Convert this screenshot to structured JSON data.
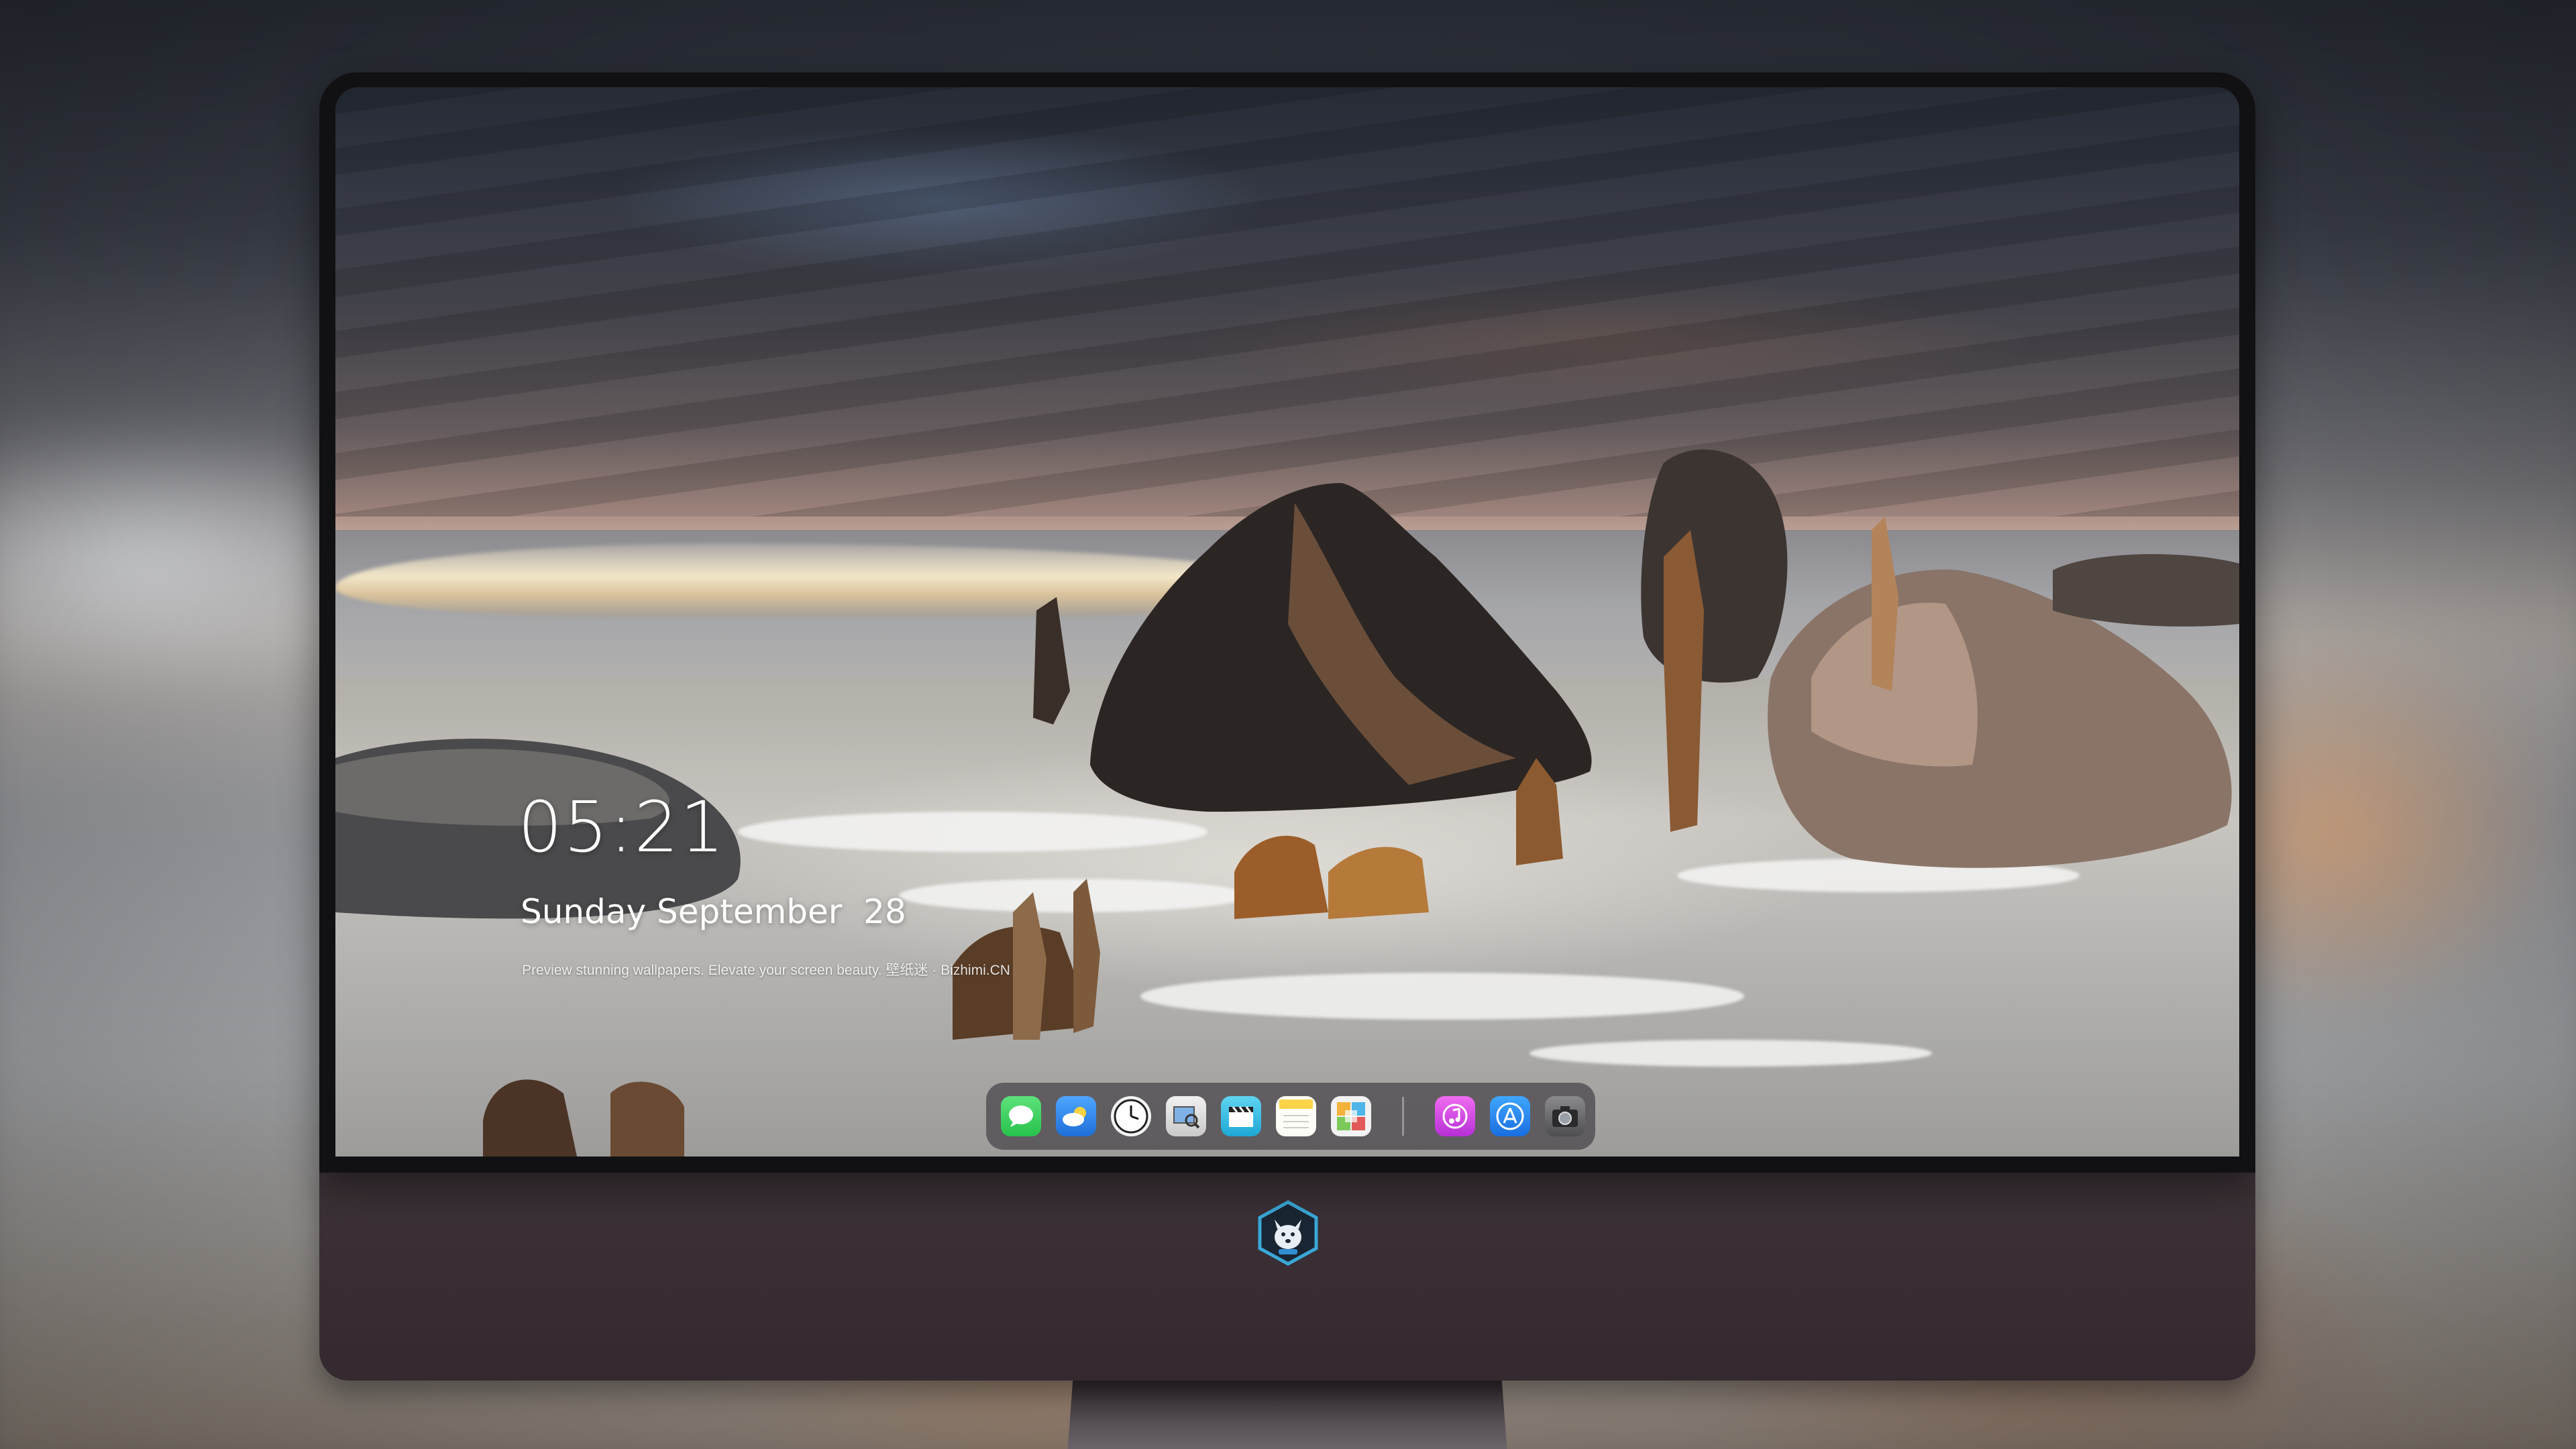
{
  "lock_screen": {
    "time": "05:21",
    "date": "Sunday September  28",
    "tagline": "Preview stunning wallpapers. Elevate your screen beauty. 壁纸迷 · Bizhimi.CN"
  },
  "dock": {
    "apps": [
      {
        "name": "Messages",
        "icon": "messages-icon",
        "color": "#2fd158"
      },
      {
        "name": "Weather",
        "icon": "weather-icon",
        "color": "#3a8ff2"
      },
      {
        "name": "Clock",
        "icon": "clock-icon",
        "color": "#f2f2f2"
      },
      {
        "name": "Preview",
        "icon": "preview-icon",
        "color": "#d9d9d9"
      },
      {
        "name": "Video",
        "icon": "clapperboard-icon",
        "color": "#38c4e8"
      },
      {
        "name": "Notes",
        "icon": "notes-icon",
        "color": "#fbd44a"
      },
      {
        "name": "Photos",
        "icon": "photos-icon",
        "color": "#f0f0f0"
      },
      {
        "name": "Music",
        "icon": "music-icon",
        "color": "#e34ee8"
      },
      {
        "name": "App Store",
        "icon": "app-store-icon",
        "color": "#2f8cf3"
      },
      {
        "name": "Camera",
        "icon": "camera-icon",
        "color": "#6a6a6e"
      }
    ]
  },
  "monitor": {
    "logo": "wolf-mascot-logo"
  }
}
